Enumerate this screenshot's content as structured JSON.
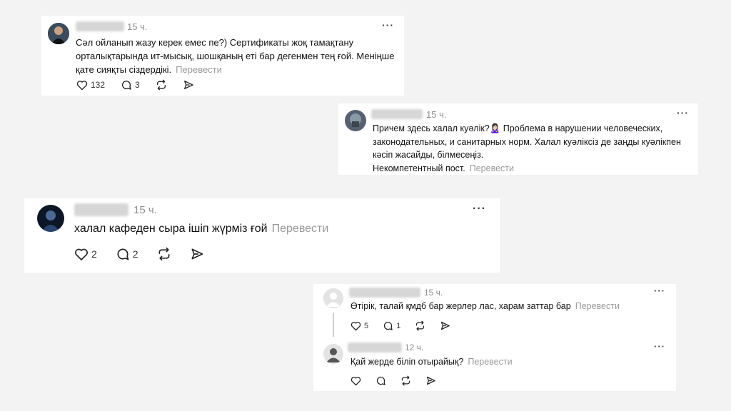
{
  "posts": [
    {
      "time": "15 ч.",
      "lines": [
        "Сәл ойланып жазу керек емес пе?) Сертификаты жоқ тамақтану",
        "орталықтарында ит-мысық, шошқаның еті бар дегенмен тең ғой. Меніңше",
        "қате сияқты сіздердікі."
      ],
      "translate": "Перевести",
      "likes": "132",
      "comments": "3"
    },
    {
      "time": "15 ч.",
      "lines": [
        "Причем здесь халал куәлік?🙎🏻‍♀️ Проблема в нарушении человеческих,",
        "законодательных, и санитарных норм. Халал куәліксіз де заңды куәлікпен",
        "кәсіп жасайды, білмесеңіз.",
        "Некомпетентный пост."
      ],
      "translate": "Перевести"
    },
    {
      "time": "15 ч.",
      "lines": [
        "халал кафеден сыра ішіп жүрміз ғой"
      ],
      "translate": "Перевести",
      "likes": "2",
      "comments": "2"
    },
    {
      "time": "15 ч.",
      "lines": [
        "Өтірік, талай қмдб бар жерлер лас, харам заттар бар"
      ],
      "translate": "Перевести",
      "likes": "5",
      "comments": "1"
    },
    {
      "time": "12 ч.",
      "lines": [
        "Қай жерде біліп отырайық?"
      ],
      "translate": "Перевести"
    }
  ],
  "icons": [
    "more-icon",
    "heart-icon",
    "comment-icon",
    "repost-icon",
    "share-icon"
  ]
}
